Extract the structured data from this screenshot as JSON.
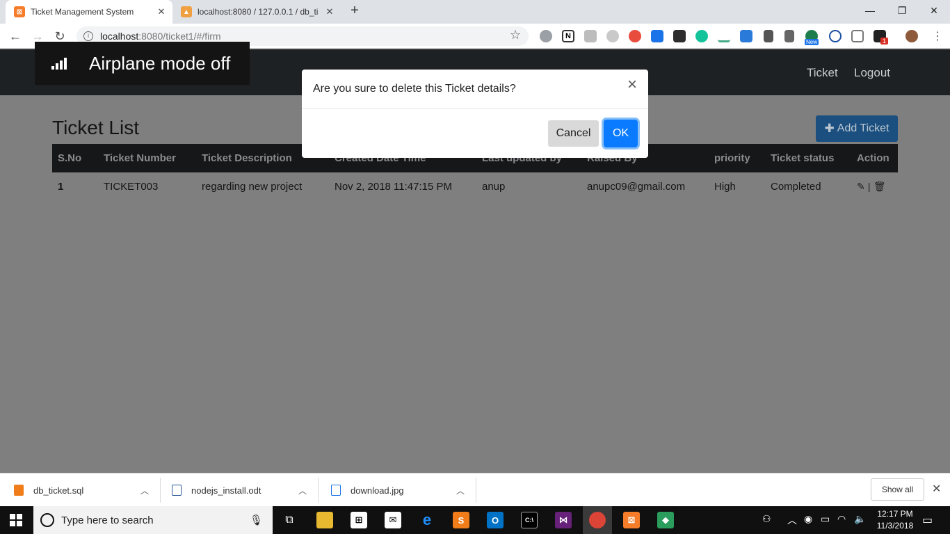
{
  "browser": {
    "tabs": [
      {
        "title": "Ticket Management System",
        "active": true
      },
      {
        "title": "localhost:8080 / 127.0.0.1 / db_ti",
        "active": false
      }
    ],
    "url_host": "localhost",
    "url_path": ":8080/ticket1/#/firm",
    "extension_badges": {
      "new_label": "New",
      "count": "1"
    }
  },
  "toast": {
    "text": "Airplane mode off"
  },
  "navbar": {
    "links": [
      "Ticket",
      "Logout"
    ]
  },
  "page": {
    "title": "Ticket List",
    "add_button_label": "Add Ticket"
  },
  "table": {
    "headers": [
      "S.No",
      "Ticket Number",
      "Ticket Description",
      "Created Date Time",
      "Last updated by",
      "Raised By",
      "priority",
      "Ticket status",
      "Action"
    ],
    "rows": [
      {
        "sno": "1",
        "ticket_number": "TICKET003",
        "description": "regarding new project",
        "created": "Nov 2, 2018 11:47:15 PM",
        "updated_by": "anup",
        "raised_by": "anupc09@gmail.com",
        "priority": "High",
        "status": "Completed",
        "action_separator": "|"
      }
    ]
  },
  "modal": {
    "title": "Are you sure to delete this Ticket details?",
    "close": "×",
    "cancel_label": "Cancel",
    "ok_label": "OK"
  },
  "downloads": {
    "items": [
      "db_ticket.sql",
      "nodejs_install.odt",
      "download.jpg"
    ],
    "show_all_label": "Show all"
  },
  "taskbar": {
    "search_placeholder": "Type here to search",
    "time": "12:17 PM",
    "date": "11/3/2018"
  },
  "colors": {
    "navbar": "#1e2123",
    "primary": "#0a7bff",
    "status_green": "#1f6a1f",
    "overlay": "#808080"
  }
}
